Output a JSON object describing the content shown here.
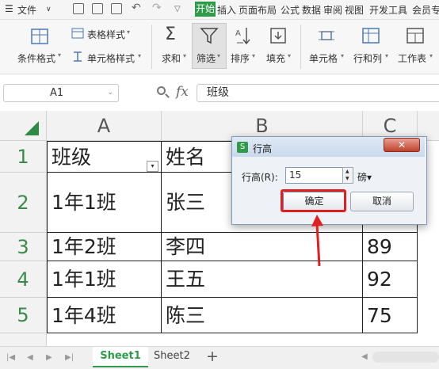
{
  "menubar": {
    "file_label": "文件",
    "tabs": [
      "开始",
      "插入",
      "页面布局",
      "公式",
      "数据",
      "审阅",
      "视图",
      "开发工具",
      "会员专"
    ]
  },
  "ribbon": {
    "conditional_format": "条件格式",
    "table_style": "表格样式",
    "cell_style": "单元格样式",
    "sum": "求和",
    "filter": "筛选",
    "sort": "排序",
    "fill": "填充",
    "cell": "单元格",
    "row_col": "行和列",
    "worksheet": "工作表"
  },
  "formula_bar": {
    "name_box": "A1",
    "fx": "fx",
    "content": "班级"
  },
  "sheet": {
    "columns": [
      "A",
      "B",
      "C"
    ],
    "rows": [
      {
        "num": "1",
        "a": "班级",
        "b": "姓名",
        "c": ""
      },
      {
        "num": "2",
        "a": "1年1班",
        "b": "张三",
        "c": ""
      },
      {
        "num": "3",
        "a": "1年2班",
        "b": "李四",
        "c": "89"
      },
      {
        "num": "4",
        "a": "1年1班",
        "b": "王五",
        "c": "92"
      },
      {
        "num": "5",
        "a": "1年4班",
        "b": "陈三",
        "c": "75"
      }
    ]
  },
  "tabs": {
    "sheet1": "Sheet1",
    "sheet2": "Sheet2",
    "add": "+"
  },
  "dialog": {
    "title": "行高",
    "logo": "S",
    "close": "✕",
    "label": "行高(R):",
    "value": "15",
    "unit": "磅▾",
    "ok": "确定",
    "cancel": "取消"
  },
  "colors": {
    "accent_green": "#2e9a4a",
    "highlight_red": "#e02020"
  }
}
